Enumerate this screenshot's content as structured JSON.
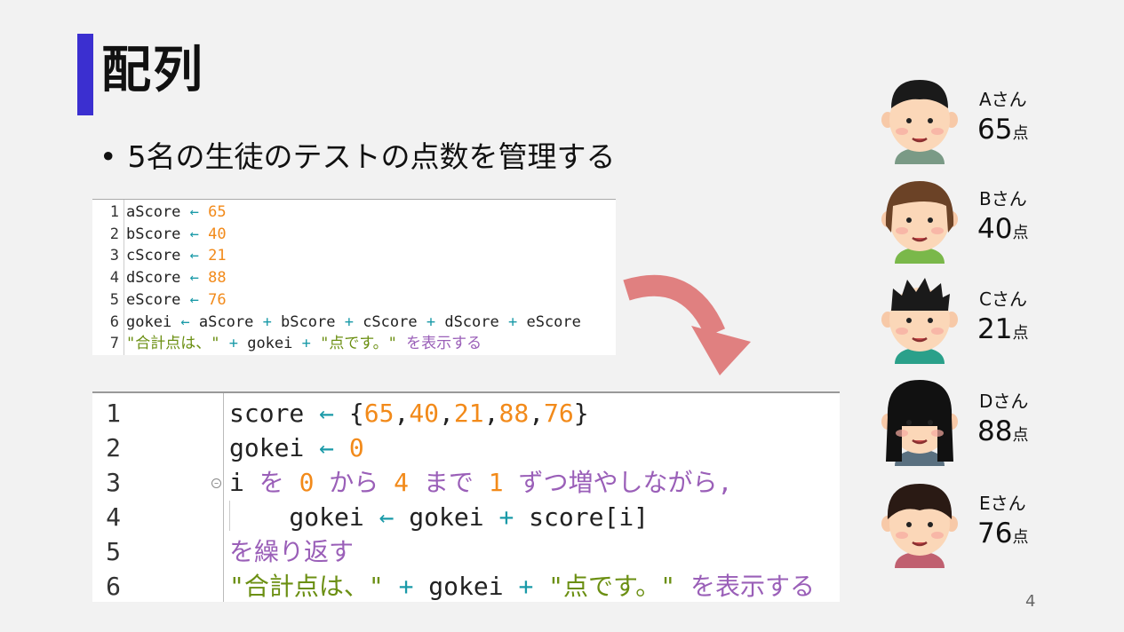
{
  "slide": {
    "title": "配列",
    "bullet": "5名の生徒のテストの点数を管理する",
    "page_number": "4"
  },
  "code_small": {
    "lines": [
      {
        "num": "1",
        "parts": [
          [
            "id",
            "aScore "
          ],
          [
            "op",
            "← "
          ],
          [
            "num",
            "65"
          ]
        ]
      },
      {
        "num": "2",
        "parts": [
          [
            "id",
            "bScore "
          ],
          [
            "op",
            "← "
          ],
          [
            "num",
            "40"
          ]
        ]
      },
      {
        "num": "3",
        "parts": [
          [
            "id",
            "cScore "
          ],
          [
            "op",
            "← "
          ],
          [
            "num",
            "21"
          ]
        ]
      },
      {
        "num": "4",
        "parts": [
          [
            "id",
            "dScore "
          ],
          [
            "op",
            "← "
          ],
          [
            "num",
            "88"
          ]
        ]
      },
      {
        "num": "5",
        "parts": [
          [
            "id",
            "eScore "
          ],
          [
            "op",
            "← "
          ],
          [
            "num",
            "76"
          ]
        ]
      },
      {
        "num": "6",
        "parts": [
          [
            "id",
            "gokei "
          ],
          [
            "op",
            "← "
          ],
          [
            "id",
            "aScore "
          ],
          [
            "op",
            "+ "
          ],
          [
            "id",
            "bScore "
          ],
          [
            "op",
            "+ "
          ],
          [
            "id",
            "cScore "
          ],
          [
            "op",
            "+ "
          ],
          [
            "id",
            "dScore "
          ],
          [
            "op",
            "+ "
          ],
          [
            "id",
            "eScore"
          ]
        ]
      },
      {
        "num": "7",
        "parts": [
          [
            "str",
            "\"合計点は、\" "
          ],
          [
            "op",
            "+ "
          ],
          [
            "id",
            "gokei "
          ],
          [
            "op",
            "+ "
          ],
          [
            "str",
            "\"点です。\" "
          ],
          [
            "kw",
            "を表示する"
          ]
        ]
      }
    ]
  },
  "code_big": {
    "lines": [
      {
        "num": "1",
        "parts": [
          [
            "id",
            "score "
          ],
          [
            "op",
            "← "
          ],
          [
            "id",
            "{"
          ],
          [
            "num",
            "65"
          ],
          [
            "id",
            ","
          ],
          [
            "num",
            "40"
          ],
          [
            "id",
            ","
          ],
          [
            "num",
            "21"
          ],
          [
            "id",
            ","
          ],
          [
            "num",
            "88"
          ],
          [
            "id",
            ","
          ],
          [
            "num",
            "76"
          ],
          [
            "id",
            "}"
          ]
        ]
      },
      {
        "num": "2",
        "parts": [
          [
            "id",
            "gokei "
          ],
          [
            "op",
            "← "
          ],
          [
            "num",
            "0"
          ]
        ]
      },
      {
        "num": "3",
        "parts": [
          [
            "id",
            "i "
          ],
          [
            "kw",
            "を "
          ],
          [
            "num",
            "0 "
          ],
          [
            "kw",
            "から "
          ],
          [
            "num",
            "4 "
          ],
          [
            "kw",
            "まで "
          ],
          [
            "num",
            "1 "
          ],
          [
            "kw",
            "ずつ増やしながら,"
          ]
        ]
      },
      {
        "num": "4",
        "parts": [
          [
            "id",
            "    gokei "
          ],
          [
            "op",
            "← "
          ],
          [
            "id",
            "gokei "
          ],
          [
            "op",
            "+ "
          ],
          [
            "id",
            "score[i]"
          ]
        ]
      },
      {
        "num": "5",
        "parts": [
          [
            "kw",
            "を繰り返す"
          ]
        ]
      },
      {
        "num": "6",
        "parts": [
          [
            "str",
            "\"合計点は、\" "
          ],
          [
            "op",
            "+ "
          ],
          [
            "id",
            "gokei "
          ],
          [
            "op",
            "+ "
          ],
          [
            "str",
            "\"点です。\" "
          ],
          [
            "kw",
            "を表示する"
          ]
        ]
      }
    ]
  },
  "students": [
    {
      "name": "Aさん",
      "score": "65",
      "unit": "点",
      "icon": "student-a-face-icon"
    },
    {
      "name": "Bさん",
      "score": "40",
      "unit": "点",
      "icon": "student-b-face-icon"
    },
    {
      "name": "Cさん",
      "score": "21",
      "unit": "点",
      "icon": "student-c-face-icon"
    },
    {
      "name": "Dさん",
      "score": "88",
      "unit": "点",
      "icon": "student-d-face-icon"
    },
    {
      "name": "Eさん",
      "score": "76",
      "unit": "点",
      "icon": "student-e-face-icon"
    }
  ],
  "colors": {
    "title_accent": "#3b2fd0",
    "number": "#f28a1a",
    "operator": "#1a9aa8",
    "keyword": "#9a5fb8",
    "string": "#6b8f12",
    "arrow": "#e08080"
  }
}
